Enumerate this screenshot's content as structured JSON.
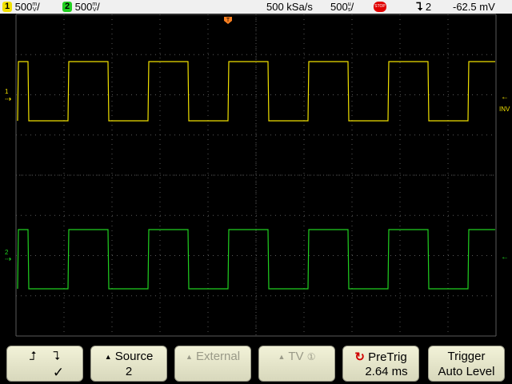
{
  "status_bar": {
    "ch1": {
      "number": "1",
      "scale": "500",
      "unit_top": "m",
      "unit_bottom": "V",
      "color": "#f0e000"
    },
    "ch2": {
      "number": "2",
      "scale": "500",
      "unit_top": "m",
      "unit_bottom": "V",
      "color": "#20d020"
    },
    "sample_rate": "500 kSa/s",
    "timebase": "500",
    "timebase_unit_top": "u",
    "timebase_unit_bottom": "s",
    "run_state": "STOP",
    "trigger_edge": "falling-edge-icon",
    "trigger_source": "2",
    "trigger_level": "-62.5 mV"
  },
  "screen": {
    "trigger_position_marker": "T",
    "ch1_ground_marker": "1",
    "ch2_ground_marker": "2",
    "ch1_side_label": "INV",
    "colors": {
      "ch1": "#f0e000",
      "ch2": "#20d020",
      "grid": "#5a5a5a",
      "trigger": "#ff8020"
    }
  },
  "softkeys": [
    {
      "line1": "",
      "line2": "✓",
      "icon": "rising-falling-edge-icon",
      "enabled": true
    },
    {
      "line1": "Source",
      "line2": "2",
      "enabled": true
    },
    {
      "line1": "External",
      "line2": "",
      "enabled": false
    },
    {
      "line1": "TV",
      "line2": "",
      "badge": "①",
      "enabled": false
    },
    {
      "line1": "PreTrig",
      "line2": "2.64 ms",
      "icon": "rotate-knob-icon",
      "enabled": true
    },
    {
      "line1": "Trigger",
      "line2": "Auto Level",
      "enabled": true
    }
  ]
}
